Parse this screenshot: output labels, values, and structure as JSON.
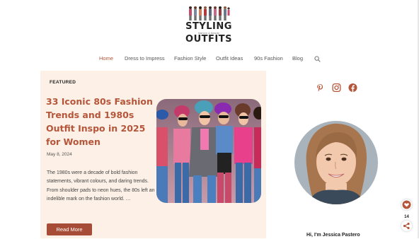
{
  "logo": {
    "line1": "STYLING",
    "tiny": "fashion & beauty",
    "line2": "OUTFITS"
  },
  "nav": {
    "items": [
      "Home",
      "Dress to Impress",
      "Fashion Style",
      "Outfit Ideas",
      "90s Fashion",
      "Blog"
    ],
    "active": "Home",
    "search_icon": "search-icon"
  },
  "featured": {
    "badge": "FEATURED",
    "title": "33 Iconic 80s Fashion Trends and 1980s Outfit Inspo in 2025 for Women",
    "date": "May 8, 2024",
    "excerpt": "The 1980s were a decade of bold fashion statements, vibrant colours, and daring trends. From shoulder pads to neon hues, the 80s left an indelible mark on the fashion world. …",
    "button": "Read More"
  },
  "sidebar": {
    "social_icons": [
      "pinterest-icon",
      "instagram-icon",
      "facebook-icon"
    ],
    "author_greeting": "Hi, I'm  Jessica Pastero"
  },
  "floating": {
    "count": "14",
    "icons": [
      "heart-icon",
      "share-icon"
    ]
  },
  "colors": {
    "accent": "#b5553a",
    "card_bg": "#fdf0e6",
    "button_bg": "#a74c36"
  }
}
